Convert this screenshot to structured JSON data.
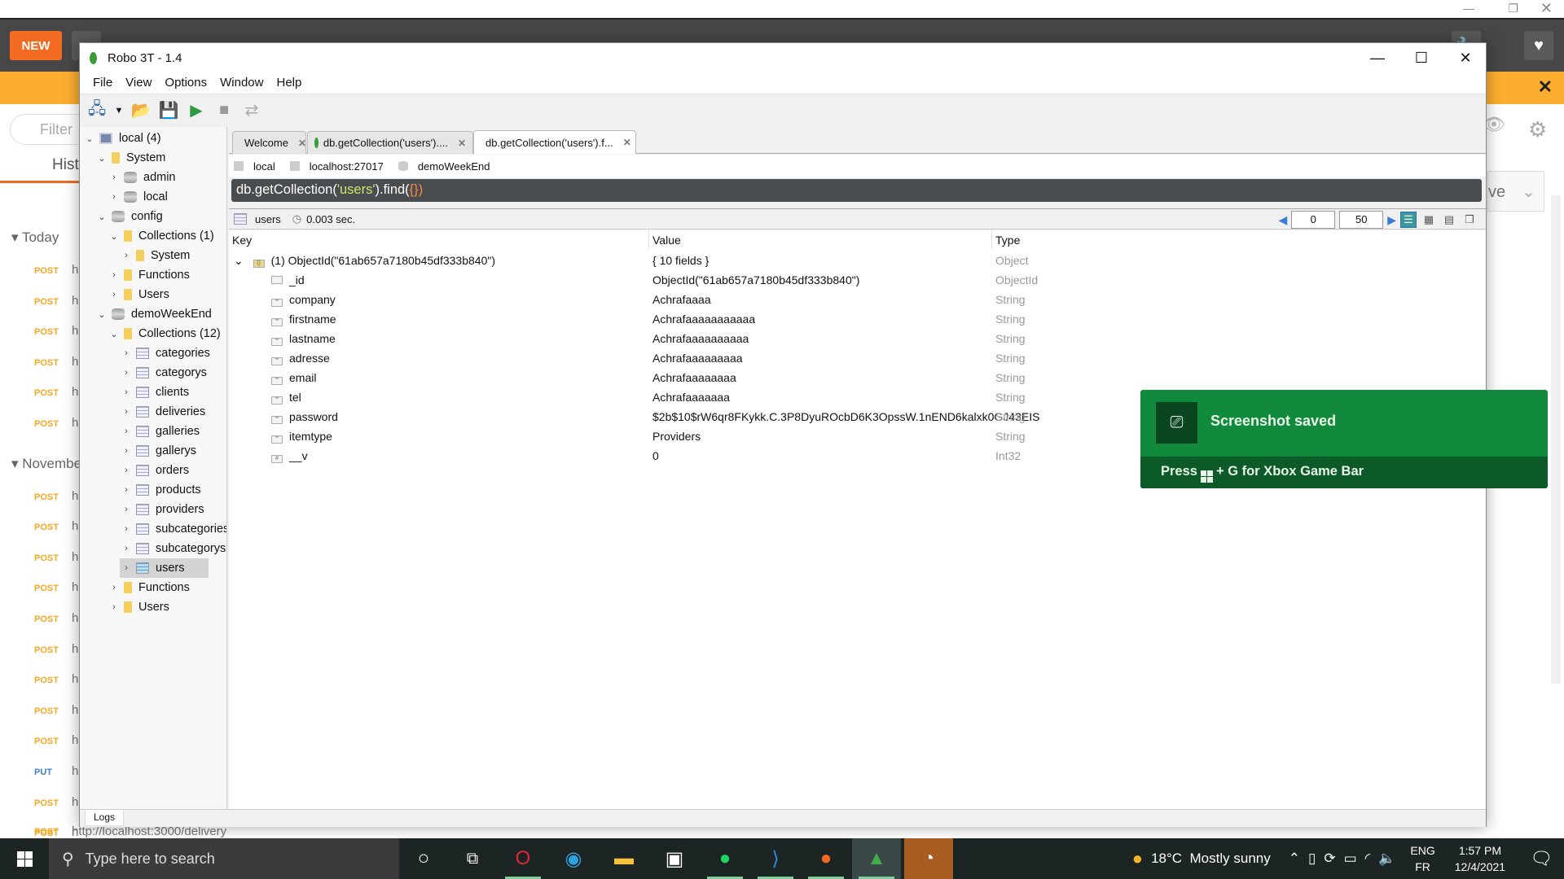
{
  "postman": {
    "new_label": "NEW",
    "filter_placeholder": "Filter",
    "history_tab": "History",
    "save_partial": "ve",
    "groups": [
      {
        "label": "Today",
        "items": [
          "POST",
          "POST",
          "POST",
          "POST",
          "POST",
          "POST"
        ]
      },
      {
        "label": "November",
        "items": [
          "POST",
          "POST",
          "POST",
          "POST",
          "POST",
          "POST",
          "POST",
          "POST",
          "POST",
          "PUT",
          "POST",
          "POST"
        ]
      }
    ],
    "last_url": "http://localhost:3000/delivery"
  },
  "robo": {
    "title": "Robo 3T - 1.4",
    "menu": [
      "File",
      "View",
      "Options",
      "Window",
      "Help"
    ],
    "tree": [
      {
        "label": "local (4)",
        "level": 0,
        "expanded": true,
        "icon": "computer"
      },
      {
        "label": "System",
        "level": 1,
        "expanded": true,
        "icon": "folder"
      },
      {
        "label": "admin",
        "level": 2,
        "expanded": false,
        "icon": "database"
      },
      {
        "label": "local",
        "level": 2,
        "expanded": false,
        "icon": "database"
      },
      {
        "label": "config",
        "level": 1,
        "expanded": true,
        "icon": "database"
      },
      {
        "label": "Collections (1)",
        "level": 2,
        "expanded": true,
        "icon": "folder"
      },
      {
        "label": "System",
        "level": 3,
        "expanded": false,
        "icon": "folder"
      },
      {
        "label": "Functions",
        "level": 2,
        "expanded": false,
        "icon": "folder"
      },
      {
        "label": "Users",
        "level": 2,
        "expanded": false,
        "icon": "folder"
      },
      {
        "label": "demoWeekEnd",
        "level": 1,
        "expanded": true,
        "icon": "database"
      },
      {
        "label": "Collections (12)",
        "level": 2,
        "expanded": true,
        "icon": "folder"
      },
      {
        "label": "categories",
        "level": 3,
        "expanded": false,
        "icon": "collection"
      },
      {
        "label": "categorys",
        "level": 3,
        "expanded": false,
        "icon": "collection"
      },
      {
        "label": "clients",
        "level": 3,
        "expanded": false,
        "icon": "collection"
      },
      {
        "label": "deliveries",
        "level": 3,
        "expanded": false,
        "icon": "collection"
      },
      {
        "label": "galleries",
        "level": 3,
        "expanded": false,
        "icon": "collection"
      },
      {
        "label": "gallerys",
        "level": 3,
        "expanded": false,
        "icon": "collection"
      },
      {
        "label": "orders",
        "level": 3,
        "expanded": false,
        "icon": "collection"
      },
      {
        "label": "products",
        "level": 3,
        "expanded": false,
        "icon": "collection"
      },
      {
        "label": "providers",
        "level": 3,
        "expanded": false,
        "icon": "collection"
      },
      {
        "label": "subcategories",
        "level": 3,
        "expanded": false,
        "icon": "collection"
      },
      {
        "label": "subcategorys",
        "level": 3,
        "expanded": false,
        "icon": "collection"
      },
      {
        "label": "users",
        "level": 3,
        "expanded": false,
        "icon": "collection",
        "selected": true
      },
      {
        "label": "Functions",
        "level": 2,
        "expanded": false,
        "icon": "folder"
      },
      {
        "label": "Users",
        "level": 2,
        "expanded": false,
        "icon": "folder"
      }
    ],
    "tabs": [
      {
        "label": "Welcome",
        "icon": "robo-icon"
      },
      {
        "label": "db.getCollection('users')....",
        "icon": "mongo-leaf-icon"
      },
      {
        "label": "db.getCollection('users').f...",
        "icon": "mongo-leaf-icon",
        "active": true
      }
    ],
    "path": {
      "server": "local",
      "host": "localhost:27017",
      "database": "demoWeekEnd"
    },
    "query": {
      "prefix": "db.getCollection(",
      "string": "'users'",
      "middle": ").find(",
      "braces": "{}",
      "suffix": ")"
    },
    "results": {
      "collection": "users",
      "time": "0.003 sec.",
      "skip": "0",
      "limit": "50",
      "columns": [
        "Key",
        "Value",
        "Type"
      ],
      "document": {
        "key": "(1) ObjectId(\"61ab657a7180b45df333b840\")",
        "value": "{ 10 fields }",
        "type": "Object"
      },
      "fields": [
        {
          "key": "_id",
          "value": "ObjectId(\"61ab657a7180b45df333b840\")",
          "type": "ObjectId",
          "icon": "objectid"
        },
        {
          "key": "company",
          "value": "Achrafaaaa",
          "type": "String",
          "icon": "string"
        },
        {
          "key": "firstname",
          "value": "Achrafaaaaaaaaaaa",
          "type": "String",
          "icon": "string"
        },
        {
          "key": "lastname",
          "value": "Achrafaaaaaaaaaa",
          "type": "String",
          "icon": "string"
        },
        {
          "key": "adresse",
          "value": "Achrafaaaaaaaaa",
          "type": "String",
          "icon": "string"
        },
        {
          "key": "email",
          "value": "Achrafaaaaaaaa",
          "type": "String",
          "icon": "string"
        },
        {
          "key": "tel",
          "value": "Achrafaaaaaaa",
          "type": "String",
          "icon": "string"
        },
        {
          "key": "password",
          "value": "$2b$10$rW6qr8FKykk.C.3P8DyuROcbD6K3OpssW.1nEND6kalxk0GJ43EIS",
          "type": "String",
          "icon": "string"
        },
        {
          "key": "itemtype",
          "value": "Providers",
          "type": "String",
          "icon": "string"
        },
        {
          "key": "__v",
          "value": "0",
          "type": "Int32",
          "icon": "number"
        }
      ]
    },
    "logs_tab": "Logs"
  },
  "toast": {
    "title": "Screenshot saved",
    "footer_pre": "Press",
    "footer_post": "+ G for Xbox Game Bar"
  },
  "taskbar": {
    "search_placeholder": "Type here to search",
    "weather": "18°C  Mostly sunny",
    "lang_top": "ENG",
    "lang_bottom": "FR",
    "time": "1:57 PM",
    "date": "12/4/2021"
  },
  "colors": {
    "accent_orange": "#f26b21",
    "toast_green": "#128a3e",
    "query_bg": "#4a4d50"
  }
}
